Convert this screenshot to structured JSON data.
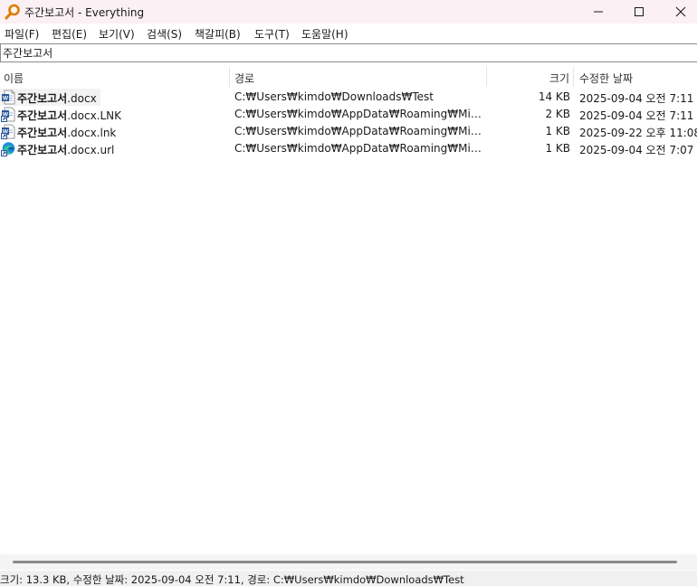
{
  "window": {
    "title": "주간보고서 - Everything"
  },
  "menu": {
    "items": [
      "파일(F)",
      "편집(E)",
      "보기(V)",
      "검색(S)",
      "책갈피(B)",
      "도구(T)",
      "도움말(H)"
    ]
  },
  "search": {
    "value": "주간보고서"
  },
  "columns": {
    "name": "이름",
    "path": "경로",
    "size": "크기",
    "modified": "수정한 날짜"
  },
  "rows": [
    {
      "name_bold": "주간보고서",
      "name_ext": ".docx",
      "path": "C:₩Users₩kimdo₩Downloads₩Test",
      "size": "14 KB",
      "modified": "2025-09-04 오전 7:11",
      "icon": "word-document-icon"
    },
    {
      "name_bold": "주간보고서",
      "name_ext": ".docx.LNK",
      "path": "C:₩Users₩kimdo₩AppData₩Roaming₩Microsoft...",
      "size": "2 KB",
      "modified": "2025-09-04 오전 7:11",
      "icon": "word-shortcut-icon"
    },
    {
      "name_bold": "주간보고서",
      "name_ext": ".docx.lnk",
      "path": "C:₩Users₩kimdo₩AppData₩Roaming₩Microsoft...",
      "size": "1 KB",
      "modified": "2025-09-22 오후 11:08",
      "icon": "word-shortcut-icon"
    },
    {
      "name_bold": "주간보고서",
      "name_ext": ".docx.url",
      "path": "C:₩Users₩kimdo₩AppData₩Roaming₩Microsoft...",
      "size": "1 KB",
      "modified": "2025-09-04 오전 7:07",
      "icon": "edge-url-icon"
    }
  ],
  "status": {
    "text": "크기: 13.3 KB, 수정한 날짜: 2025-09-04 오전 7:11, 경로: C:₩Users₩kimdo₩Downloads₩Test"
  },
  "colors": {
    "titlebar_bg": "#fbf0f3",
    "app_icon": "#e07b00",
    "word_blue": "#2b579a",
    "status_bg": "#f0f0f0"
  }
}
